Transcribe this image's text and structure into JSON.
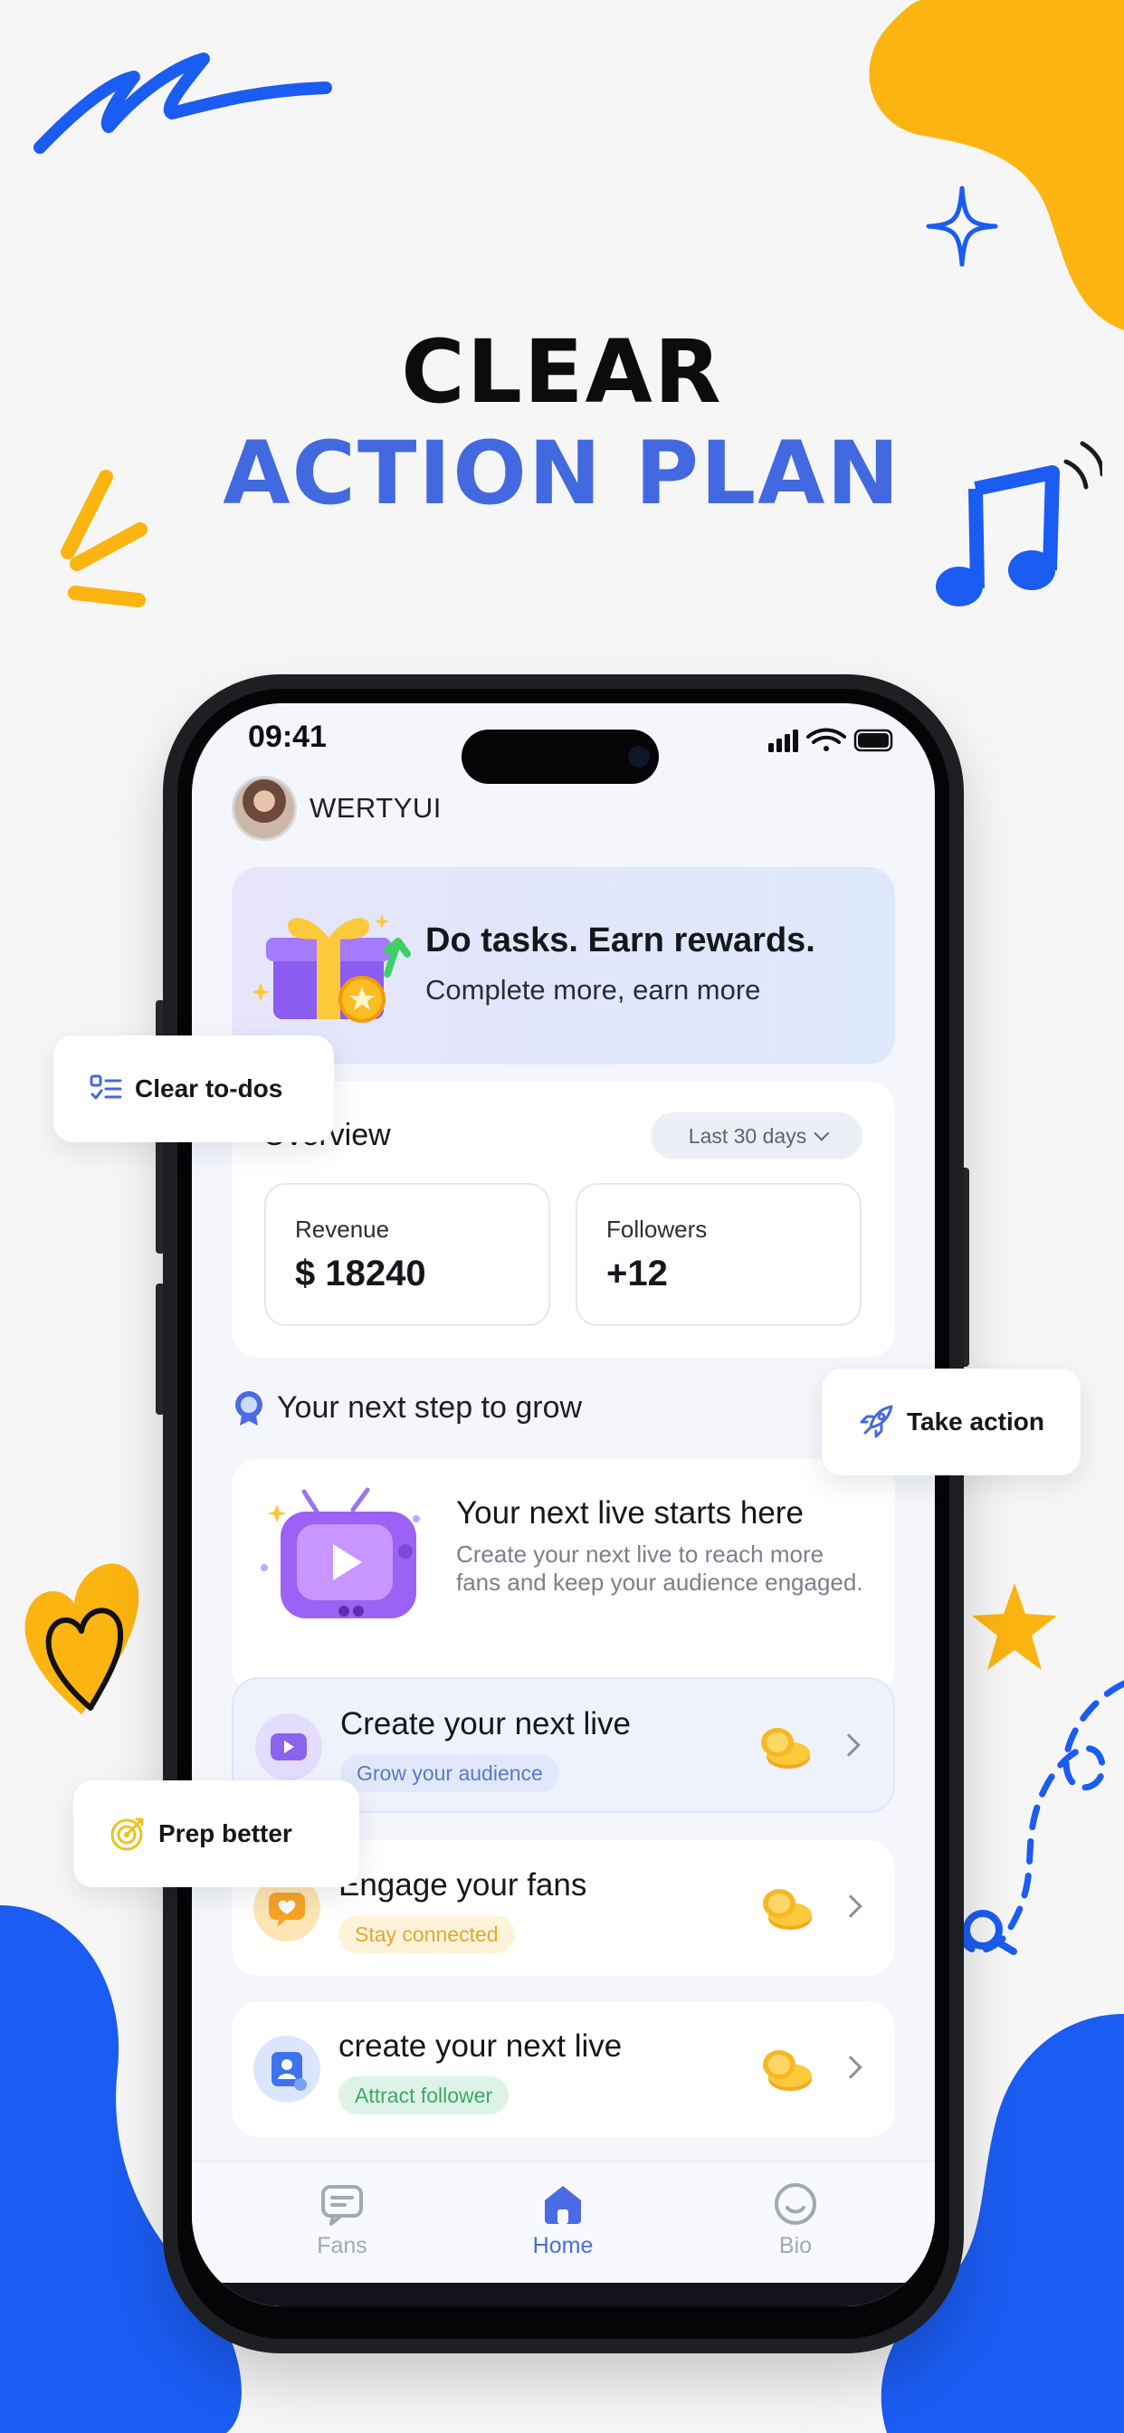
{
  "headline": {
    "line1": "CLEAR",
    "line2": "ACTION PLAN"
  },
  "status_bar": {
    "time": "09:41"
  },
  "profile": {
    "name": "WERTYUI"
  },
  "rewards": {
    "title": "Do tasks. Earn rewards.",
    "subtitle": "Complete more, earn more"
  },
  "overview": {
    "title": "Overview",
    "range": "Last 30 days",
    "stats": [
      {
        "label": "Revenue",
        "value": "$ 18240"
      },
      {
        "label": "Followers",
        "value": "+12"
      }
    ]
  },
  "grow": {
    "title": "Your next step to grow"
  },
  "live_card": {
    "title": "Your next live starts here",
    "description": "Create your next live to reach more fans and keep your audience engaged."
  },
  "tasks": [
    {
      "title": "Create your next live",
      "tag": "Grow your audience"
    },
    {
      "title": "Engage your fans",
      "tag": "Stay connected"
    },
    {
      "title": "create your next live",
      "tag": "Attract follower"
    }
  ],
  "tabbar": [
    {
      "label": "Fans",
      "icon": "chat-icon"
    },
    {
      "label": "Home",
      "icon": "home-icon"
    },
    {
      "label": "Bio",
      "icon": "smile-icon"
    }
  ],
  "chips": {
    "todo": "Clear to-dos",
    "action": "Take action",
    "prep": "Prep better"
  },
  "colors": {
    "accent_blue": "#4369e0",
    "brand_yellow": "#fcb411",
    "brand_blue": "#1b5cf2",
    "tag_blue_bg": "#e2e8fb",
    "tag_yellow_bg": "#fff3da",
    "tag_green_bg": "#def3e7"
  }
}
